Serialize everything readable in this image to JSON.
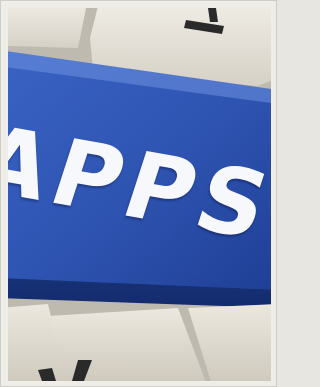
{
  "key": {
    "label": "APPS"
  },
  "colors": {
    "key_blue": "#2f55b3",
    "key_blue_dark": "#1c3a8c",
    "key_blue_light": "#5d83d8",
    "keycap_beige": "#e4e0d6",
    "keycap_shadow": "#b8b3a8",
    "glyph_dark": "#2a2a2a"
  }
}
